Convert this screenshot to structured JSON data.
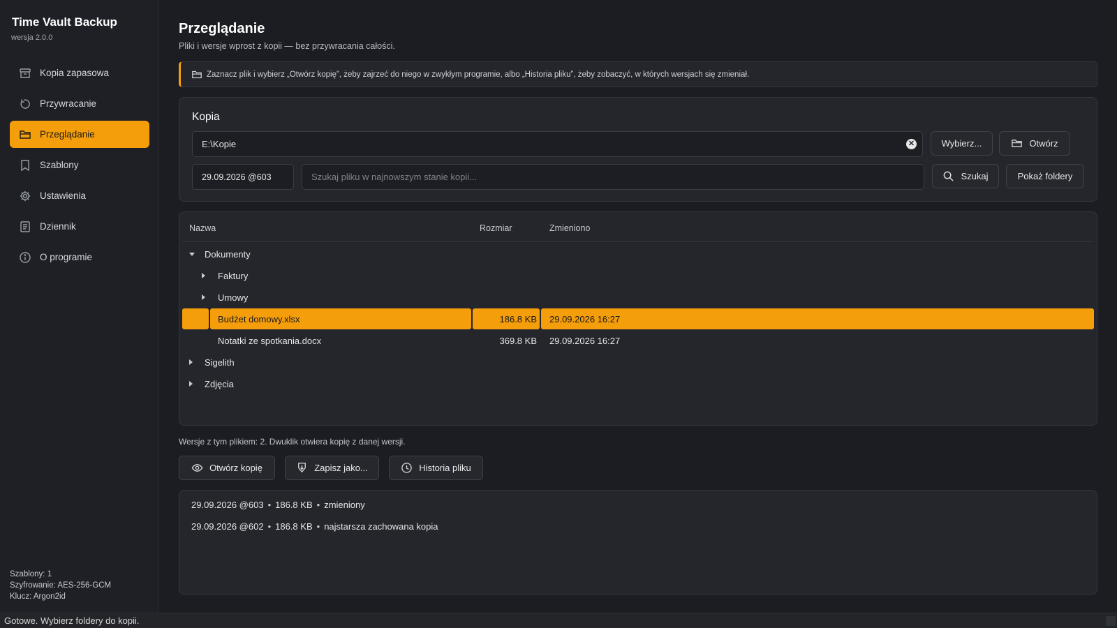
{
  "app": {
    "title": "Time Vault Backup",
    "version": "wersja 2.0.0"
  },
  "sidebar": {
    "items": [
      {
        "label": "Kopia zapasowa",
        "icon": "archive-icon"
      },
      {
        "label": "Przywracanie",
        "icon": "restore-icon"
      },
      {
        "label": "Przeglądanie",
        "icon": "folder-icon",
        "active": true
      },
      {
        "label": "Szablony",
        "icon": "bookmark-icon"
      },
      {
        "label": "Ustawienia",
        "icon": "gear-icon"
      },
      {
        "label": "Dziennik",
        "icon": "log-icon"
      },
      {
        "label": "O programie",
        "icon": "info-icon"
      }
    ],
    "footer": {
      "templates": "Szablony: 1",
      "encryption": "Szyfrowanie: AES-256-GCM",
      "key": "Klucz: Argon2id"
    }
  },
  "page": {
    "title": "Przeglądanie",
    "subtitle": "Pliki i wersje wprost z kopii — bez przywracania całości.",
    "info": "Zaznacz plik i wybierz „Otwórz kopię”, żeby zajrzeć do niego w zwykłym programie, albo „Historia pliku”, żeby zobaczyć, w których wersjach się zmieniał."
  },
  "kopia": {
    "title": "Kopia",
    "path": "E:\\Kopie",
    "choose_label": "Wybierz...",
    "open_label": "Otwórz",
    "version": "29.09.2026 @603",
    "search_placeholder": "Szukaj pliku w najnowszym stanie kopii...",
    "search_label": "Szukaj",
    "show_folders_label": "Pokaż foldery"
  },
  "tree": {
    "columns": {
      "name": "Nazwa",
      "size": "Rozmiar",
      "changed": "Zmieniono"
    },
    "rows": [
      {
        "name": "Dokumenty",
        "level": 0,
        "expander": "down",
        "size": "",
        "date": ""
      },
      {
        "name": "Faktury",
        "level": 1,
        "expander": "right",
        "size": "",
        "date": ""
      },
      {
        "name": "Umowy",
        "level": 1,
        "expander": "right",
        "size": "",
        "date": ""
      },
      {
        "name": "Budżet domowy.xlsx",
        "level": 1,
        "expander": "",
        "size": "186.8 KB",
        "date": "29.09.2026 16:27",
        "selected": true
      },
      {
        "name": "Notatki ze spotkania.docx",
        "level": 1,
        "expander": "",
        "size": "369.8 KB",
        "date": "29.09.2026 16:27"
      },
      {
        "name": "Sigelith",
        "level": 0,
        "expander": "right",
        "size": "",
        "date": ""
      },
      {
        "name": "Zdjęcia",
        "level": 0,
        "expander": "right",
        "size": "",
        "date": ""
      }
    ]
  },
  "versions": {
    "note": "Wersje z tym plikiem: 2. Dwuklik otwiera kopię z danej wersji.",
    "open_copy_label": "Otwórz kopię",
    "save_as_label": "Zapisz jako...",
    "history_label": "Historia pliku",
    "list": [
      {
        "version": "29.09.2026 @603",
        "size": "186.8 KB",
        "note": "zmieniony"
      },
      {
        "version": "29.09.2026 @602",
        "size": "186.8 KB",
        "note": "najstarsza zachowana kopia"
      }
    ]
  },
  "status": "Gotowe. Wybierz foldery do kopii.",
  "colors": {
    "accent": "#f59e0b",
    "background": "#1b1d22",
    "panel": "#24262c"
  }
}
